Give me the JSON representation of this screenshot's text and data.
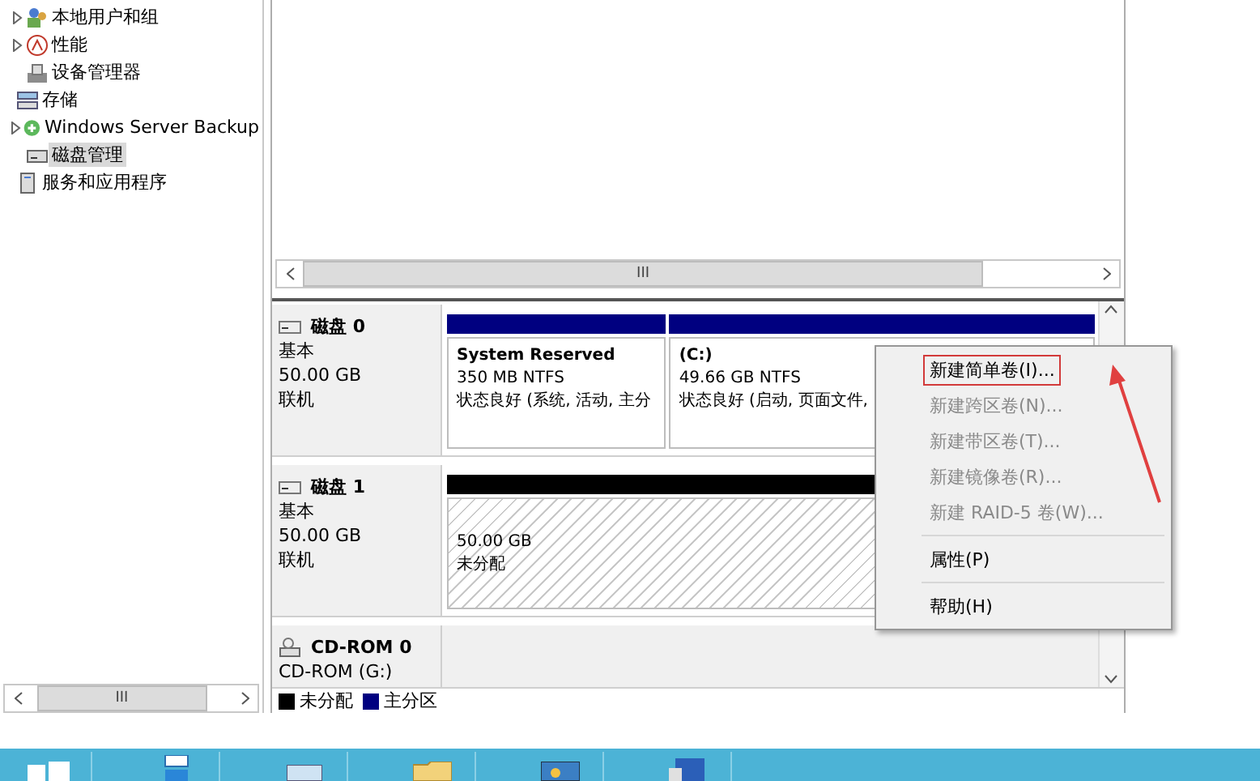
{
  "tree": [
    {
      "children": [
        {
          "label": "本地用户和组",
          "expanded": false,
          "selected": false
        },
        {
          "label": "性能",
          "expanded": false,
          "selected": false
        },
        {
          "label": "设备管理器",
          "selected": false
        }
      ]
    },
    {
      "label": "存储",
      "selected": false,
      "children": [
        {
          "label": "Windows Server Backup",
          "expanded": false,
          "selected": false
        },
        {
          "label": "磁盘管理",
          "selected": true
        }
      ]
    },
    {
      "label": "服务和应用程序",
      "selected": false
    }
  ],
  "left_scrollbar_grip": "III",
  "upper_scrollbar_grip": "III",
  "disks": [
    {
      "kind": "disk",
      "name": "磁盘 0",
      "type": "基本",
      "size": "50.00 GB",
      "status": "联机",
      "partitions": [
        {
          "kind": "primary",
          "name": "System Reserved",
          "size": "350 MB NTFS",
          "status": "状态良好 (系统, 活动, 主分"
        },
        {
          "kind": "primary",
          "name": "(C:)",
          "size": "49.66 GB NTFS",
          "status": "状态良好 (启动, 页面文件,"
        }
      ]
    },
    {
      "kind": "disk",
      "name": "磁盘 1",
      "type": "基本",
      "size": "50.00 GB",
      "status": "联机",
      "partitions": [
        {
          "kind": "unallocated",
          "size": "50.00 GB",
          "status": "未分配"
        }
      ]
    },
    {
      "kind": "cdrom",
      "name": "CD-ROM 0",
      "type": "CD-ROM (G:)"
    }
  ],
  "legend": [
    {
      "label": "未分配",
      "color": "#000000"
    },
    {
      "label": "主分区",
      "color": "#000080"
    }
  ],
  "context_menu": [
    {
      "kind": "item",
      "label": "新建简单卷(I)...",
      "disabled": false,
      "highlighted": true
    },
    {
      "kind": "item",
      "label": "新建跨区卷(N)...",
      "disabled": true,
      "highlighted": false
    },
    {
      "kind": "item",
      "label": "新建带区卷(T)...",
      "disabled": true,
      "highlighted": false
    },
    {
      "kind": "item",
      "label": "新建镜像卷(R)...",
      "disabled": true,
      "highlighted": false
    },
    {
      "kind": "item",
      "label": "新建 RAID-5 卷(W)...",
      "disabled": true,
      "highlighted": false
    },
    {
      "kind": "separator"
    },
    {
      "kind": "item",
      "label": "属性(P)",
      "disabled": false,
      "highlighted": false
    },
    {
      "kind": "separator"
    },
    {
      "kind": "item",
      "label": "帮助(H)",
      "disabled": false,
      "highlighted": false
    }
  ]
}
